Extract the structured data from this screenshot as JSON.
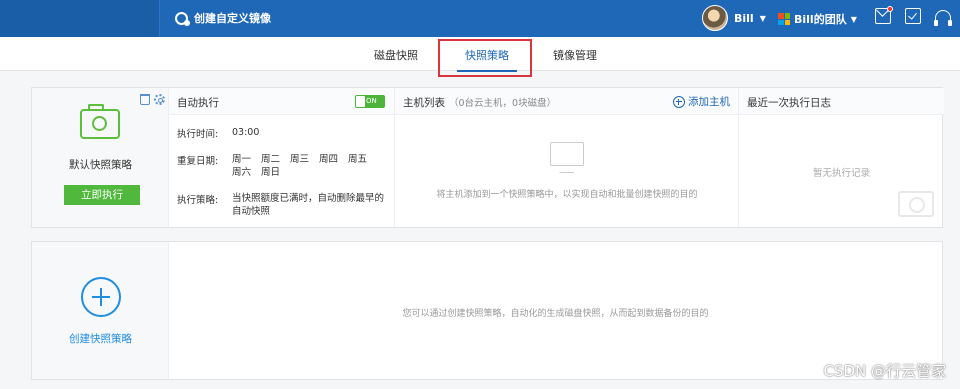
{
  "header": {
    "title": "创建自定义镜像",
    "user_name": "Bill",
    "team_name": "Bill的团队"
  },
  "tabs": [
    {
      "label": "磁盘快照",
      "active": false
    },
    {
      "label": "快照策略",
      "active": true
    },
    {
      "label": "镜像管理",
      "active": false
    }
  ],
  "policy": {
    "name": "默认快照策略",
    "run_now": "立即执行",
    "auto_title": "自动执行",
    "toggle": "ON",
    "time_label": "执行时间:",
    "time_value": "03:00",
    "repeat_label": "重复日期:",
    "days": [
      "周一",
      "周二",
      "周三",
      "周四",
      "周五",
      "周六",
      "周日"
    ],
    "strategy_label": "执行策略:",
    "strategy_value": "当快照额度已满时，自动删除最早的自动快照"
  },
  "hosts": {
    "title": "主机列表",
    "count": "（0台云主机，0块磁盘）",
    "add": "添加主机",
    "empty": "将主机添加到一个快照策略中，以实现自动和批量创建快照的目的"
  },
  "log": {
    "title": "最近一次执行日志",
    "empty": "暂无执行记录"
  },
  "create": {
    "label": "创建快照策略",
    "hint": "您可以通过创建快照策略，自动化的生成磁盘快照，从而起到数据备份的目的"
  },
  "watermark": "CSDN @行云管家",
  "colors": {
    "topbar": "#1f68b8",
    "accent_green": "#50b83c",
    "highlight": "#d9363e"
  }
}
